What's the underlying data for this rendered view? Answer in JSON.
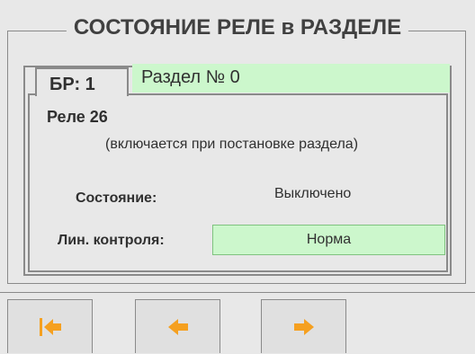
{
  "header": {
    "title": "СОСТОЯНИЕ РЕЛЕ в РАЗДЕЛЕ"
  },
  "tab": {
    "br_label": "БР: 1",
    "section_name": "Раздел № 0"
  },
  "relay": {
    "title": "Реле 26",
    "description": "(включается при постановке раздела)",
    "state_label": "Состояние:",
    "state_value": "Выключено",
    "line_label": "Лин. контроля:",
    "line_value": "Норма"
  },
  "toolbar": {
    "buttons": [
      {
        "icon": "first-arrow-icon"
      },
      {
        "icon": "left-arrow-icon"
      },
      {
        "icon": "right-arrow-icon"
      }
    ]
  },
  "colors": {
    "accent_green": "#ccf7cc",
    "arrow_orange": "#f5a020",
    "background": "#e8e8e8"
  }
}
